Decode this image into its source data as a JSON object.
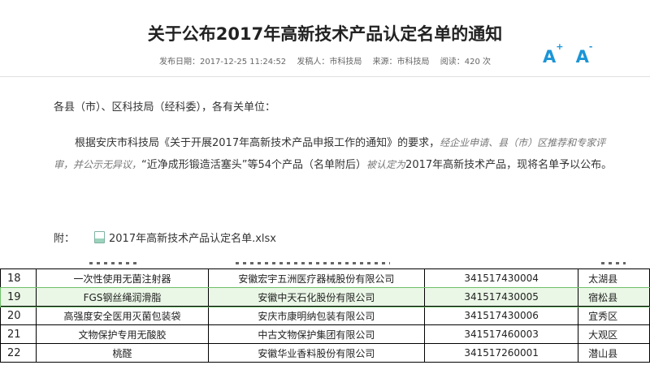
{
  "article": {
    "title": "关于公布2017年高新技术产品认定名单的通知",
    "meta": {
      "publish_date": "发布日期：2017-12-25 11:24:52",
      "sender": "发稿人：市科技局",
      "source": "来源：市科技局",
      "views": "阅读：420 次"
    },
    "font_controls": {
      "increase": "A",
      "increase_sup": "+",
      "decrease": "A",
      "decrease_sup": "-"
    },
    "salutation": "各县（市）、区科技局（经科委），各有关单位：",
    "para_1a": "根据安庆市科技局《关于开展2017年高新技术产品申报工作的通知》的要求，",
    "para_1b": "经企业申请、县（市）区推荐和专家评审，并公示无异议，",
    "para_1c": "“近净成形锻造活塞头”等54个产品（名单附后）",
    "para_1d": "被认定为",
    "para_1e": "2017年高新技术产品，现将名单予以公布。",
    "attachment_label": "附：",
    "attachment_file": "2017年高新技术产品认定名单.xlsx"
  },
  "table": {
    "rows": [
      {
        "no": "18",
        "name": "一次性使用无菌注射器",
        "company": "安徽宏宇五洲医疗器械股份有限公司",
        "code": "341517430004",
        "area": "太湖县"
      },
      {
        "no": "19",
        "name": "FGS钢丝绳润滑脂",
        "company": "安徽中天石化股份有限公司",
        "code": "341517430005",
        "area": "宿松县"
      },
      {
        "no": "20",
        "name": "高强度安全医用灭菌包装袋",
        "company": "安庆市康明纳包装有限公司",
        "code": "341517430006",
        "area": "宜秀区"
      },
      {
        "no": "21",
        "name": "文物保护专用无酸胶",
        "company": "中古文物保护集团有限公司",
        "code": "341517460003",
        "area": "大观区"
      },
      {
        "no": "22",
        "name": "桃醛",
        "company": "安徽华业香料股份有限公司",
        "code": "341517260001",
        "area": "潜山县"
      }
    ]
  }
}
